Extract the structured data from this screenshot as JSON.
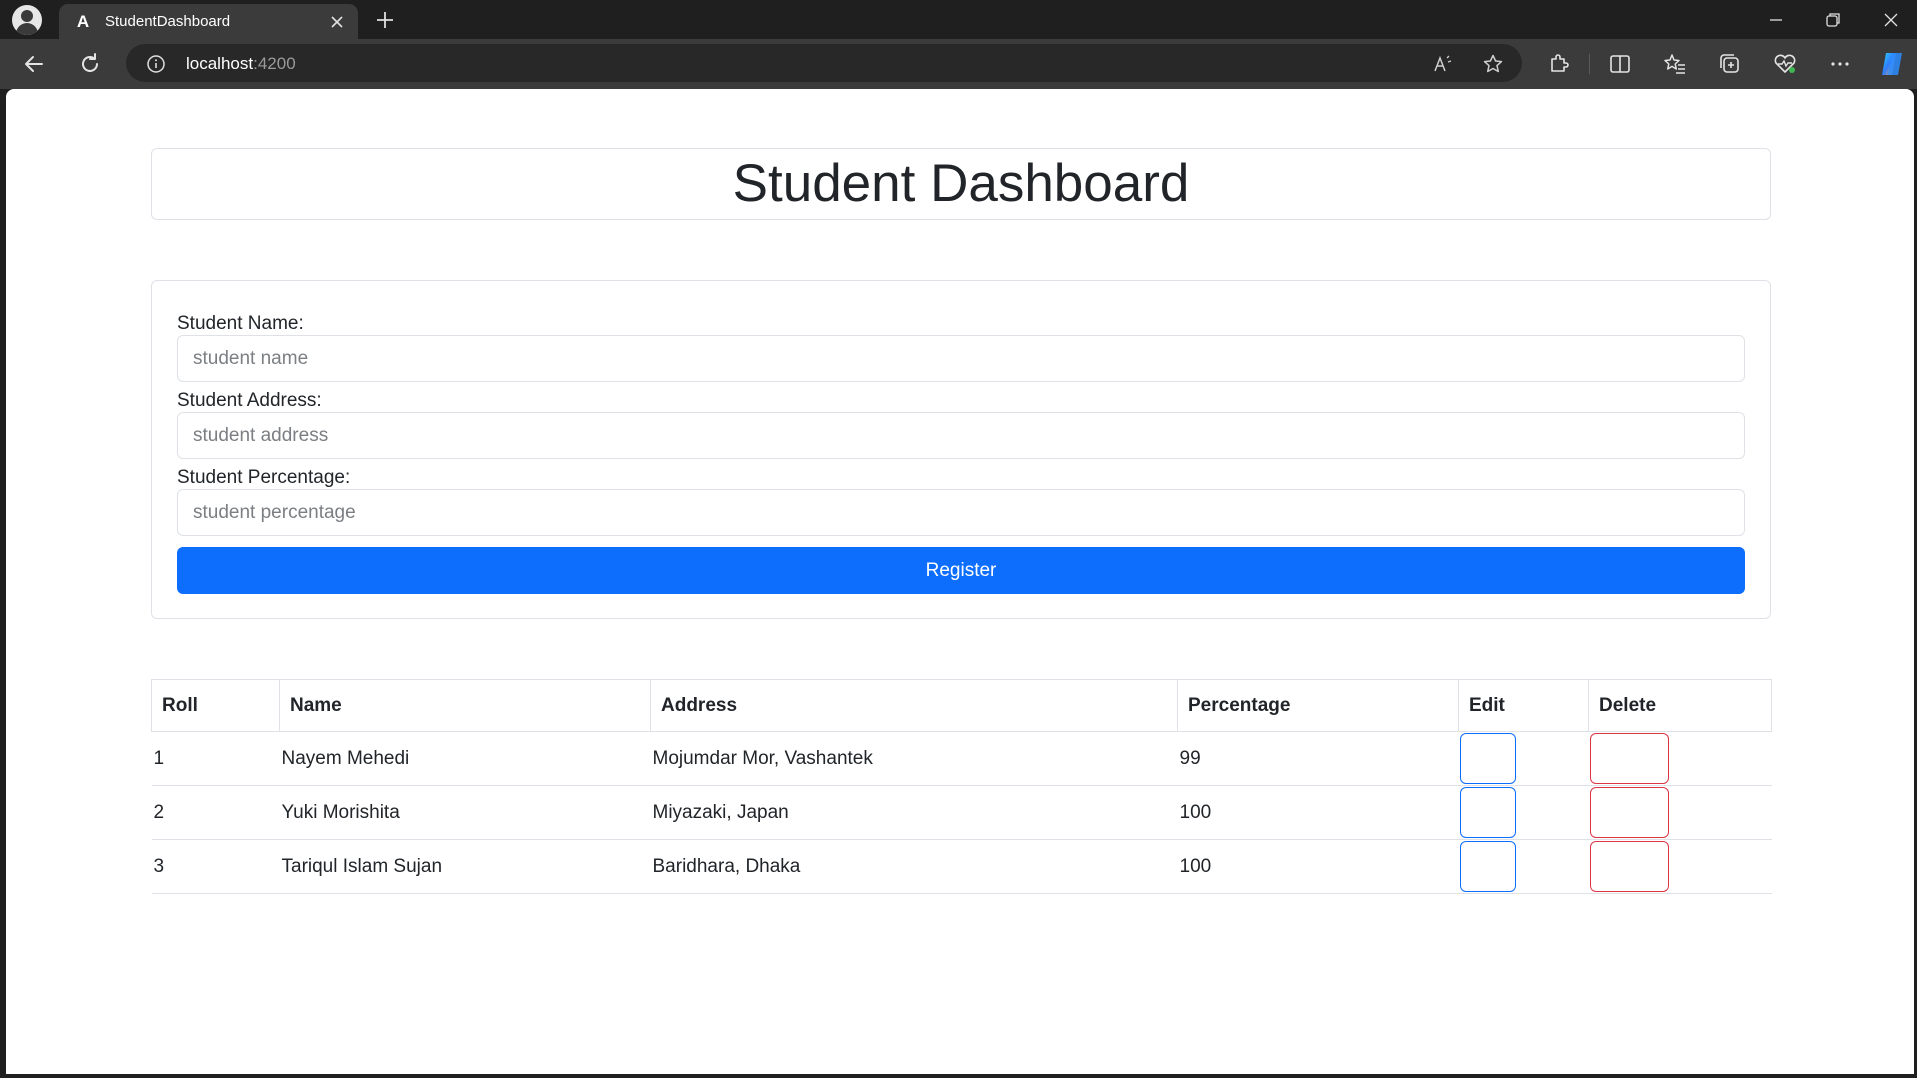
{
  "browser": {
    "tab_title": "StudentDashboard",
    "favicon_letter": "A",
    "url_host": "localhost",
    "url_port": ":4200"
  },
  "page": {
    "title": "Student Dashboard"
  },
  "form": {
    "name_label": "Student Name:",
    "name_placeholder": "student name",
    "name_value": "",
    "address_label": "Student Address:",
    "address_placeholder": "student address",
    "address_value": "",
    "percentage_label": "Student Percentage:",
    "percentage_placeholder": "student percentage",
    "percentage_value": "",
    "register_label": "Register"
  },
  "table": {
    "headers": [
      "Roll",
      "Name",
      "Address",
      "Percentage",
      "Edit",
      "Delete"
    ],
    "rows": [
      {
        "roll": "1",
        "name": "Nayem Mehedi",
        "address": "Mojumdar Mor, Vashantek",
        "percentage": "99"
      },
      {
        "roll": "2",
        "name": "Yuki Morishita",
        "address": "Miyazaki, Japan",
        "percentage": "100"
      },
      {
        "roll": "3",
        "name": "Tariqul Islam Sujan",
        "address": "Baridhara, Dhaka",
        "percentage": "100"
      }
    ]
  },
  "colors": {
    "primary": "#0d6efd",
    "danger": "#dc3545",
    "border": "#dee2e6",
    "text": "#212529"
  }
}
